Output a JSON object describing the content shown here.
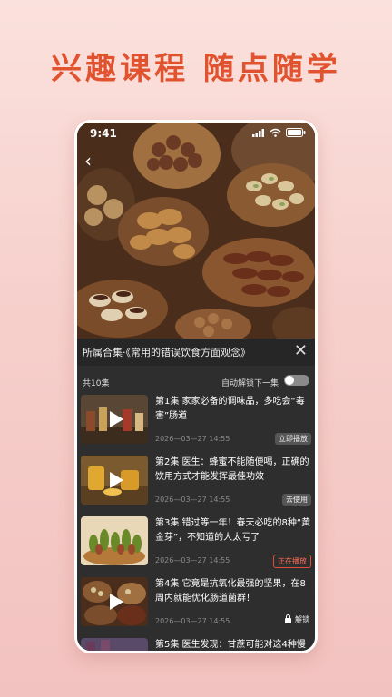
{
  "headline": "兴趣课程 随点随学",
  "status_bar": {
    "time": "9:41"
  },
  "panel": {
    "collection_title": "所属合集·《常用的错误饮食方面观念》",
    "episode_count": "共10集",
    "autoplay_label": "自动解锁下一集"
  },
  "episodes": [
    {
      "title": "第1集  家家必备的调味品，多吃会“毒害”肠道",
      "date": "2026—03—27 14:55",
      "badge": "立即播放"
    },
    {
      "title": "第2集  医生：蜂蜜不能随便喝，正确的饮用方式才能发挥最佳功效",
      "date": "2026—03—27 14:55",
      "badge": "去使用"
    },
    {
      "title": "第3集  错过等一年！春天必吃的8种“黄金芽”，不知道的人太亏了",
      "date": "2026—03—27 14:55",
      "badge": "正在播放"
    },
    {
      "title": "第4集  它竟是抗氧化最强的坚果，在8周内就能优化肠道菌群！",
      "date": "2026—03—27 14:55",
      "badge": "解锁"
    },
    {
      "title": "第5集  医生发现：甘蔗可能对这4种慢",
      "date": "",
      "badge": ""
    }
  ]
}
